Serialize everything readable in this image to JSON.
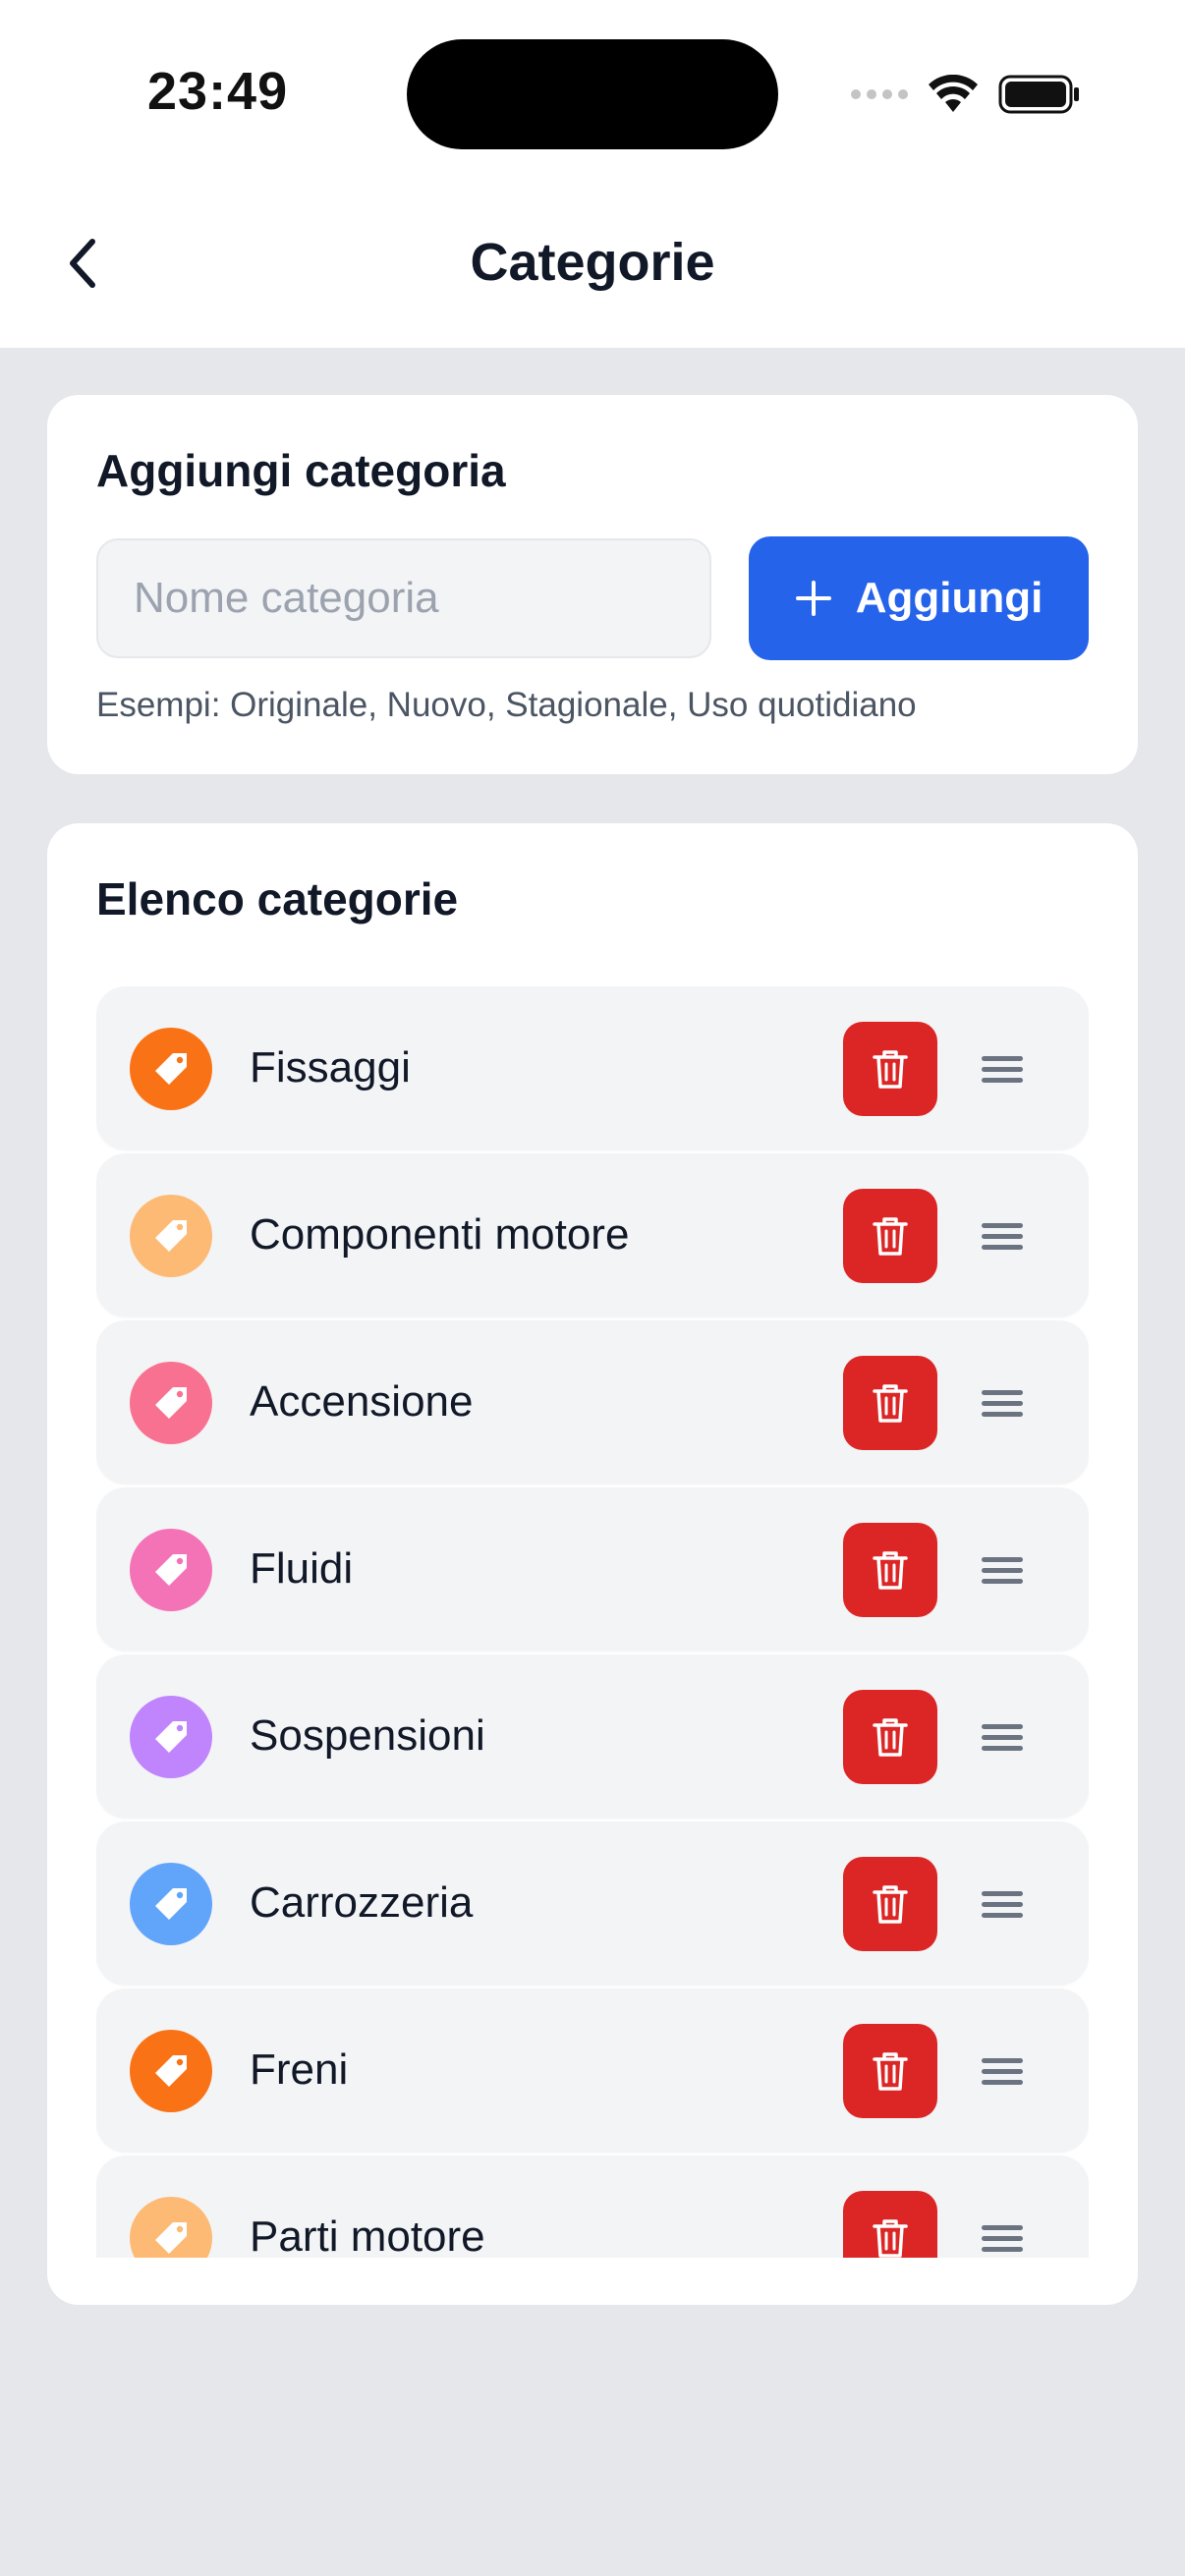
{
  "status_bar": {
    "time": "23:49"
  },
  "nav": {
    "title": "Categorie",
    "back_icon": "chevron-left-icon"
  },
  "add_card": {
    "title": "Aggiungi categoria",
    "input_placeholder": "Nome categoria",
    "input_value": "",
    "button_label": "Aggiungi",
    "button_icon": "plus-icon",
    "examples": "Esempi: Originale, Nuovo, Stagionale, Uso quotidiano"
  },
  "list_card": {
    "title": "Elenco categorie"
  },
  "categories": [
    {
      "label": "Fissaggi",
      "color": "#f97316"
    },
    {
      "label": "Componenti motore",
      "color": "#fdba74"
    },
    {
      "label": "Accensione",
      "color": "#f87191"
    },
    {
      "label": "Fluidi",
      "color": "#f472b6"
    },
    {
      "label": "Sospensioni",
      "color": "#c084fc"
    },
    {
      "label": "Carrozzeria",
      "color": "#60a5fa"
    },
    {
      "label": "Freni",
      "color": "#f97316"
    },
    {
      "label": "Parti motore",
      "color": "#fdba74"
    }
  ],
  "colors": {
    "primary": "#2563eb",
    "danger": "#dc2626",
    "background": "#e5e7eb"
  }
}
